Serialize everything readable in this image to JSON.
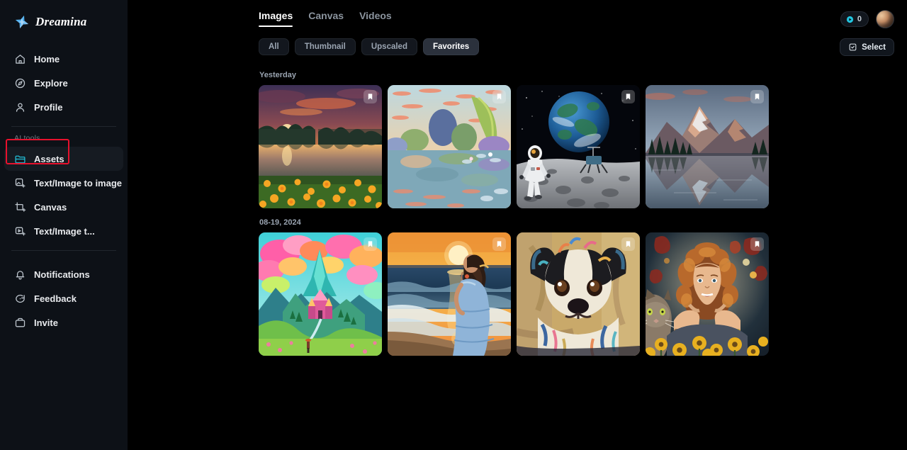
{
  "brand": {
    "name": "Dreamina",
    "logo_icon": "star-logo-icon"
  },
  "sidebar": {
    "primary": [
      {
        "label": "Home",
        "icon": "home-icon"
      },
      {
        "label": "Explore",
        "icon": "compass-icon"
      },
      {
        "label": "Profile",
        "icon": "user-icon"
      }
    ],
    "group_label": "AI tools",
    "tools": [
      {
        "label": "Assets",
        "icon": "folder-icon",
        "active": true
      },
      {
        "label": "Text/Image to image",
        "icon": "image-generate-icon",
        "active": false
      },
      {
        "label": "Canvas",
        "icon": "canvas-icon",
        "active": false
      },
      {
        "label": "Text/Image t...",
        "icon": "video-generate-icon",
        "active": false
      }
    ],
    "secondary": [
      {
        "label": "Notifications",
        "icon": "bell-icon"
      },
      {
        "label": "Feedback",
        "icon": "chat-icon"
      },
      {
        "label": "Invite",
        "icon": "invite-icon"
      }
    ]
  },
  "header": {
    "tabs": [
      {
        "label": "Images",
        "active": true
      },
      {
        "label": "Canvas",
        "active": false
      },
      {
        "label": "Videos",
        "active": false
      }
    ],
    "credits": {
      "value": "0",
      "icon": "credit-coin-icon"
    },
    "avatar": {
      "icon": "user-avatar"
    },
    "select_button": {
      "label": "Select",
      "icon": "select-box-icon"
    }
  },
  "filters": [
    {
      "label": "All",
      "active": false
    },
    {
      "label": "Thumbnail",
      "active": false
    },
    {
      "label": "Upscaled",
      "active": false
    },
    {
      "label": "Favorites",
      "active": true
    }
  ],
  "gallery": {
    "groups": [
      {
        "date": "Yesterday",
        "items": [
          {
            "art": "sunset-lake-flowers",
            "bookmarked": true
          },
          {
            "art": "impressionist-lily-pond",
            "bookmarked": true
          },
          {
            "art": "astronaut-moon-earth",
            "bookmarked": true
          },
          {
            "art": "mountain-lake-reflection",
            "bookmarked": true
          }
        ]
      },
      {
        "date": "08-19, 2024",
        "items": [
          {
            "art": "fantasy-castle-mountain",
            "bookmarked": true
          },
          {
            "art": "woman-beach-sunset",
            "bookmarked": true
          },
          {
            "art": "painted-puppy-portrait",
            "bookmarked": true
          },
          {
            "art": "girl-cat-sunflowers",
            "bookmarked": true
          }
        ]
      }
    ]
  },
  "annotation": {
    "highlight_color": "#e8112d",
    "target": "Assets"
  },
  "colors": {
    "sidebar_bg": "#0d1117",
    "main_bg": "#000000",
    "accent_cyan": "#22c6e0",
    "active_chip_bg": "#2b313c",
    "text_primary": "#ffffff",
    "text_muted": "#8b949e"
  }
}
